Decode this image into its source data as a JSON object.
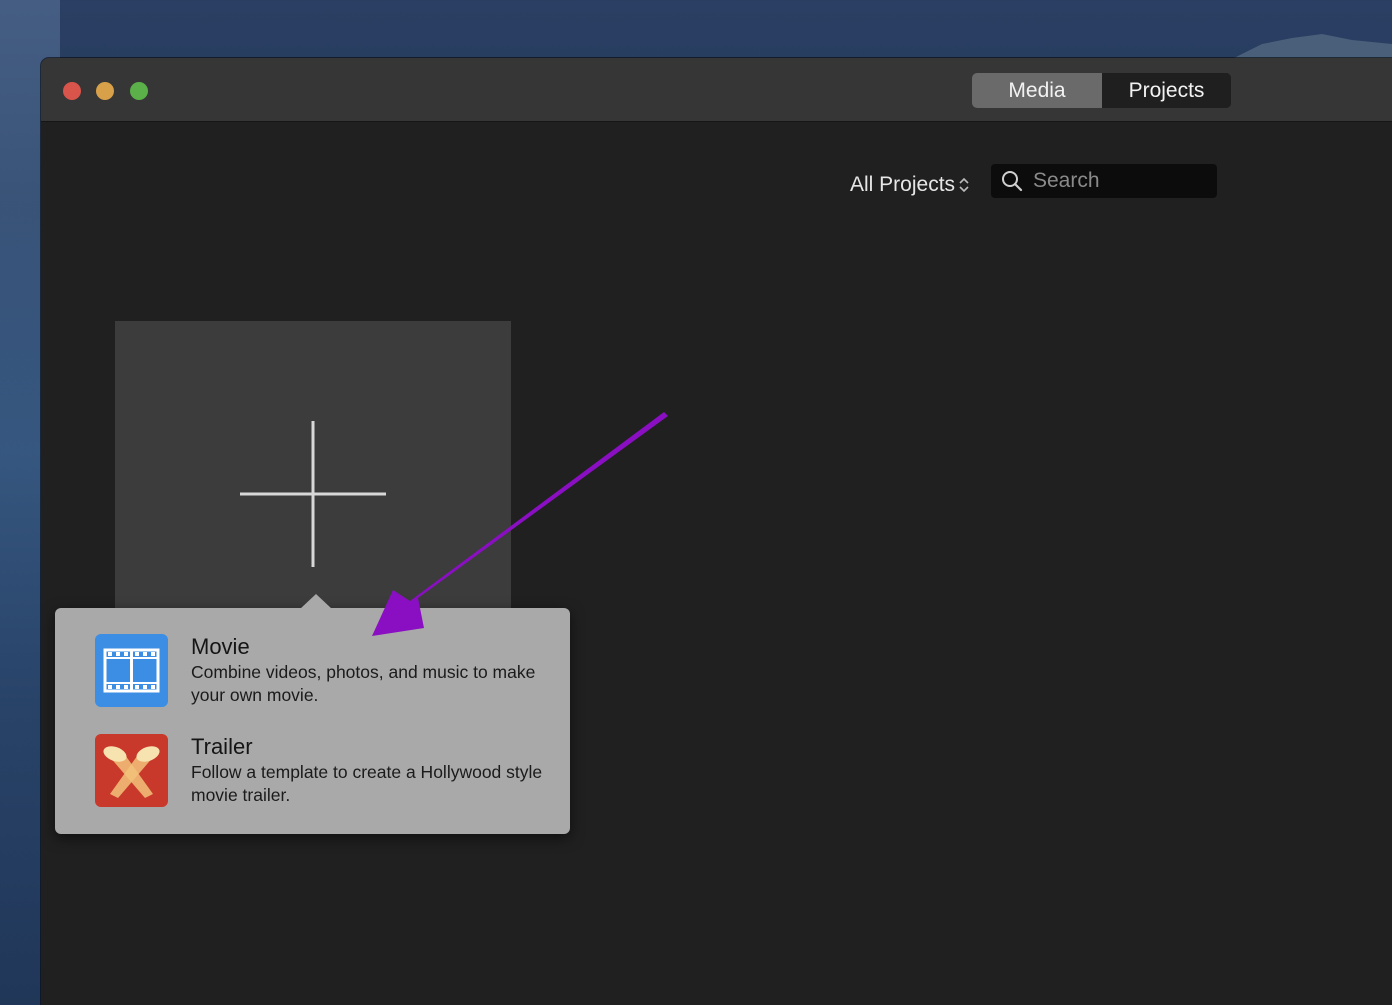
{
  "window": {
    "segmented": {
      "media_label": "Media",
      "projects_label": "Projects",
      "selected": "Media"
    }
  },
  "toolbar": {
    "filter_label": "All Projects",
    "search_placeholder": "Search"
  },
  "popover": {
    "options": [
      {
        "title": "Movie",
        "description": "Combine videos, photos, and music to make your own movie.",
        "icon": "film-strip-icon"
      },
      {
        "title": "Trailer",
        "description": "Follow a template to create a Hollywood style movie trailer.",
        "icon": "spotlights-icon"
      }
    ]
  },
  "annotation": {
    "arrow_color": "#8a0fc2"
  },
  "colors": {
    "window_bg": "#202020",
    "titlebar": "#363636",
    "popover_bg": "#a9a9a9",
    "movie_icon_bg": "#3b8ee3",
    "trailer_icon_bg": "#c8392b"
  }
}
